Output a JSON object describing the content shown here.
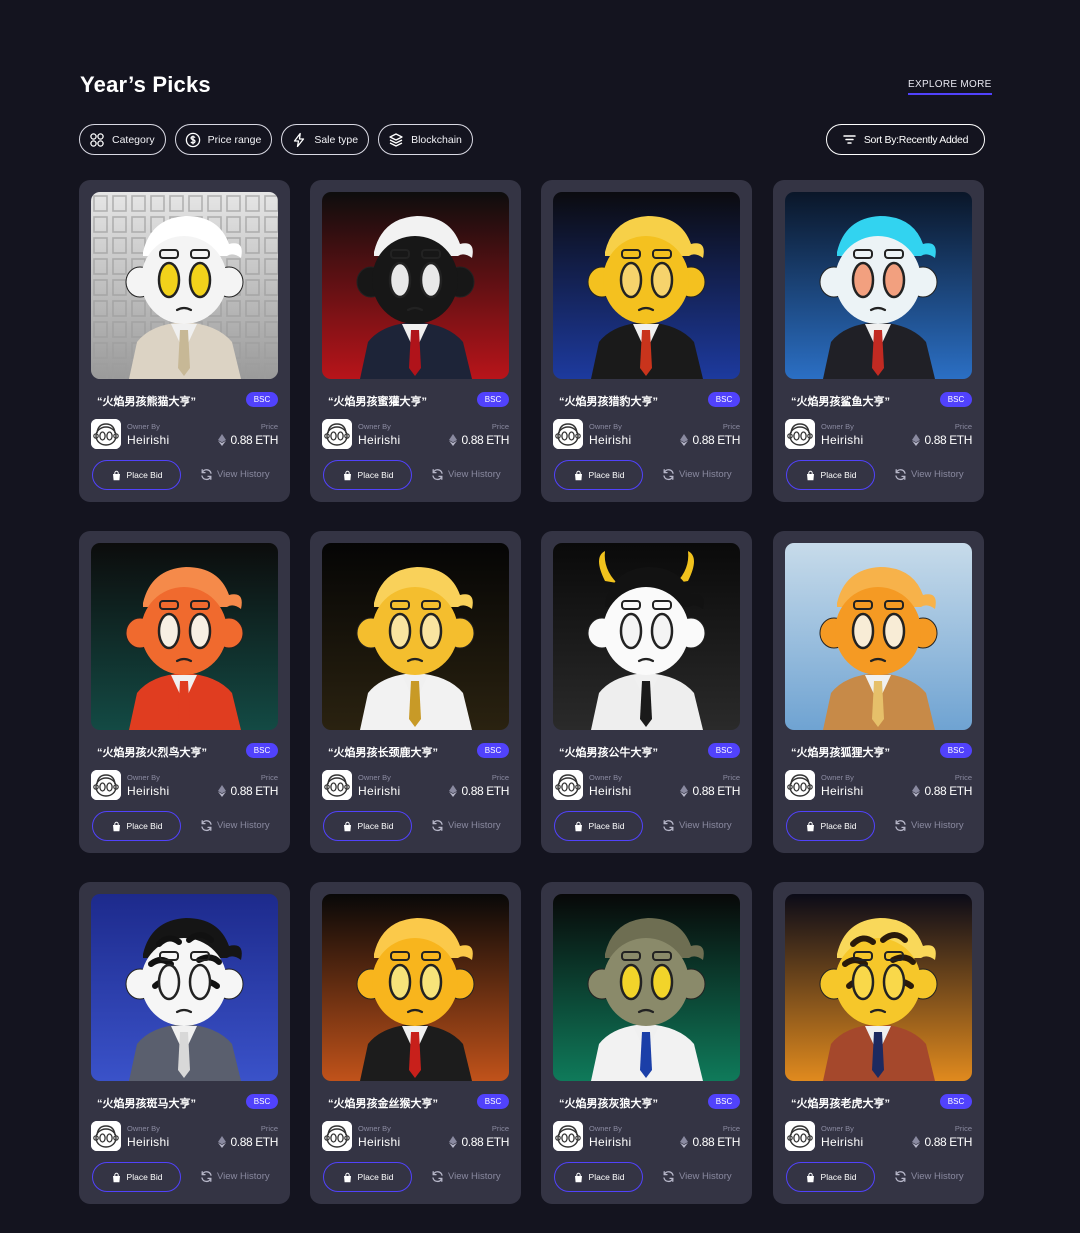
{
  "section": {
    "title": "Year’s Picks",
    "explore_label": "EXPLORE MORE"
  },
  "filters": [
    {
      "label": "Category",
      "icon": "category-grid-icon"
    },
    {
      "label": "Price range",
      "icon": "dollar-coin-icon"
    },
    {
      "label": "Sale type",
      "icon": "lightning-icon"
    },
    {
      "label": "Blockchain",
      "icon": "layers-stack-icon"
    }
  ],
  "sort": {
    "label": "Sort By:Recently Added",
    "icon": "sort-lines-icon"
  },
  "card_common": {
    "owner_label": "Owner By",
    "price_label": "Price",
    "bid_label": "Place Bid",
    "history_label": "View History",
    "badge": "BSC"
  },
  "cards": [
    {
      "name": "“火焰男孩熊猫大亨”",
      "owner": "Heirishi",
      "price": "0.88 ETH",
      "art": "panda"
    },
    {
      "name": "“火焰男孩蜜獾大亨”",
      "owner": "Heirishi",
      "price": "0.88 ETH",
      "art": "honey-badger"
    },
    {
      "name": "“火焰男孩猎豹大亨”",
      "owner": "Heirishi",
      "price": "0.88 ETH",
      "art": "cheetah"
    },
    {
      "name": "“火焰男孩鲨鱼大亨”",
      "owner": "Heirishi",
      "price": "0.88 ETH",
      "art": "shark"
    },
    {
      "name": "“火焰男孩火烈鸟大亨”",
      "owner": "Heirishi",
      "price": "0.88 ETH",
      "art": "flamingo"
    },
    {
      "name": "“火焰男孩长颈鹿大亨”",
      "owner": "Heirishi",
      "price": "0.88 ETH",
      "art": "giraffe"
    },
    {
      "name": "“火焰男孩公牛大亨”",
      "owner": "Heirishi",
      "price": "0.88 ETH",
      "art": "bull"
    },
    {
      "name": "“火焰男孩狐狸大亨”",
      "owner": "Heirishi",
      "price": "0.88 ETH",
      "art": "fox"
    },
    {
      "name": "“火焰男孩斑马大亨”",
      "owner": "Heirishi",
      "price": "0.88 ETH",
      "art": "zebra"
    },
    {
      "name": "“火焰男孩金丝猴大亨”",
      "owner": "Heirishi",
      "price": "0.88 ETH",
      "art": "golden-monkey"
    },
    {
      "name": "“火焰男孩灰狼大亨”",
      "owner": "Heirishi",
      "price": "0.88 ETH",
      "art": "grey-wolf"
    },
    {
      "name": "“火焰男孩老虎大亨”",
      "owner": "Heirishi",
      "price": "0.88 ETH",
      "art": "tiger"
    }
  ],
  "colors": {
    "background": "#14141f",
    "card": "#343444",
    "accent": "#5142fc",
    "muted": "#8a8aa0"
  }
}
